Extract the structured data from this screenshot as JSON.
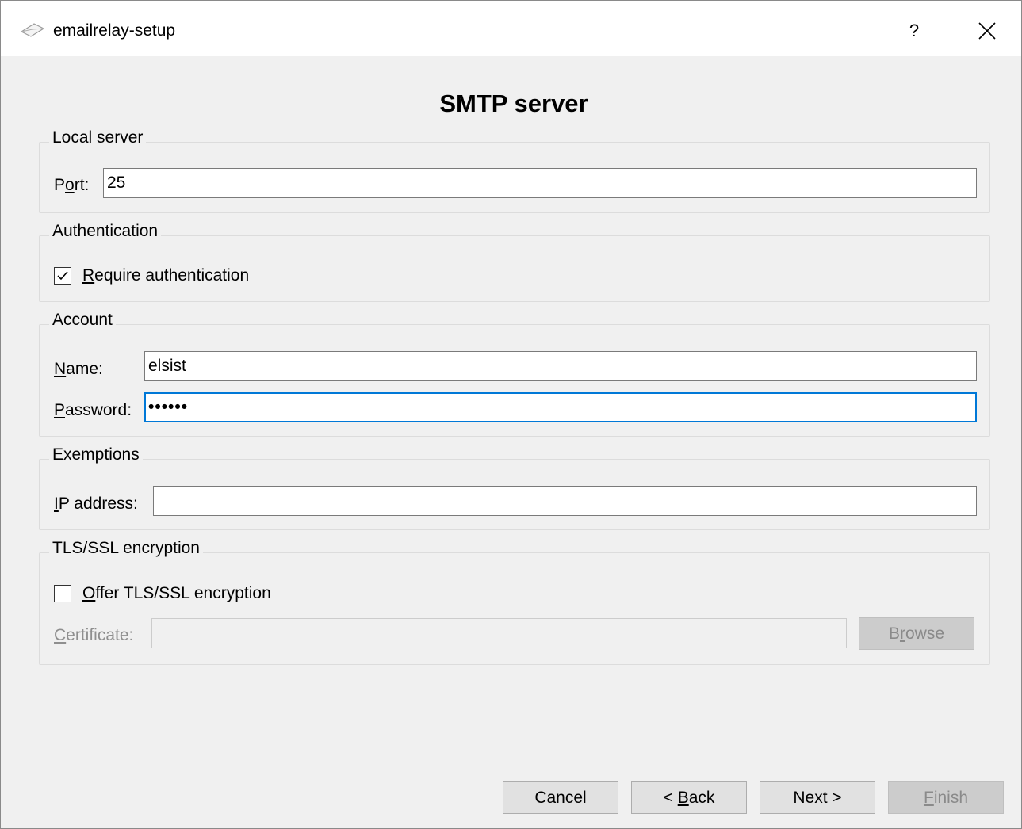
{
  "window": {
    "title": "emailrelay-setup",
    "help_glyph": "?",
    "app_icon": "envelope-icon",
    "close_icon": "close-icon"
  },
  "page": {
    "heading": "SMTP server"
  },
  "local_server": {
    "legend": "Local server",
    "port_label_pre": "P",
    "port_label_mnemonic": "o",
    "port_label_post": "rt:",
    "port_value": "25"
  },
  "authentication": {
    "legend": "Authentication",
    "checkbox_checked": true,
    "checkbox_label_mnemonic": "R",
    "checkbox_label_post": "equire authentication"
  },
  "account": {
    "legend": "Account",
    "name_label_mnemonic": "N",
    "name_label_post": "ame:",
    "name_value": "elsist",
    "password_label_mnemonic": "P",
    "password_label_post": "assword:",
    "password_value": "••••••"
  },
  "exemptions": {
    "legend": "Exemptions",
    "ip_label_mnemonic": "I",
    "ip_label_post": "P address:",
    "ip_value": ""
  },
  "tls": {
    "legend": "TLS/SSL encryption",
    "checkbox_checked": false,
    "offer_label_mnemonic": "O",
    "offer_label_post": "ffer TLS/SSL encryption",
    "cert_label_mnemonic": "C",
    "cert_label_post": "ertificate:",
    "cert_value": "",
    "browse_pre": "B",
    "browse_mnemonic": "r",
    "browse_post": "owse"
  },
  "footer": {
    "cancel": "Cancel",
    "back_pre": "< ",
    "back_mnemonic": "B",
    "back_post": "ack",
    "next": "Next >",
    "finish_mnemonic": "F",
    "finish_post": "inish"
  },
  "colors": {
    "focus": "#0078d7",
    "window_bg": "#f0f0f0",
    "disabled_text": "#8f8f8f"
  }
}
